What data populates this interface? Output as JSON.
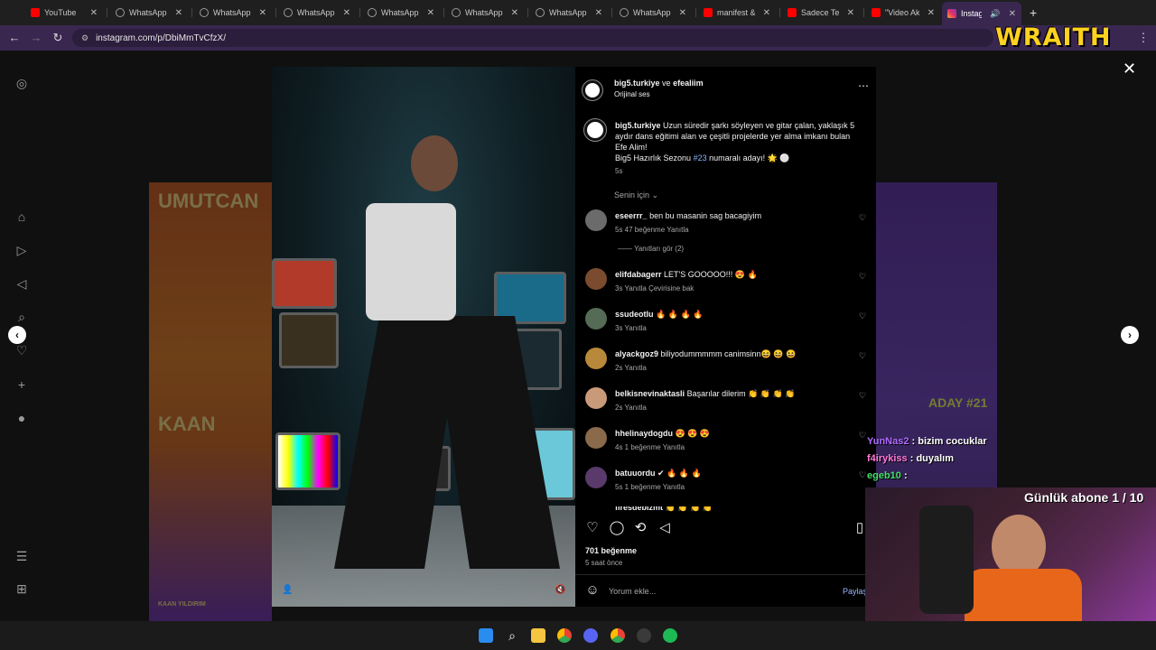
{
  "browser": {
    "tabs": [
      {
        "title": "YouTube",
        "icon": "youtube-icon"
      },
      {
        "title": "WhatsApp I",
        "icon": "whatsapp-icon"
      },
      {
        "title": "WhatsApp I",
        "icon": "whatsapp-icon"
      },
      {
        "title": "WhatsApp I",
        "icon": "whatsapp-icon"
      },
      {
        "title": "WhatsApp I",
        "icon": "whatsapp-icon"
      },
      {
        "title": "WhatsApp I",
        "icon": "whatsapp-icon"
      },
      {
        "title": "WhatsApp I",
        "icon": "whatsapp-icon"
      },
      {
        "title": "WhatsApp I",
        "icon": "whatsapp-icon"
      },
      {
        "title": "manifest & N",
        "icon": "youtube-icon"
      },
      {
        "title": "Sadece Teks",
        "icon": "youtube-icon"
      },
      {
        "title": "\"Video Akyo",
        "icon": "youtube-icon"
      },
      {
        "title": "Instagra",
        "icon": "instagram-icon",
        "active": true
      }
    ],
    "url": "instagram.com/p/DbiMmTvCfzX/",
    "new_tab": "+"
  },
  "overlay": {
    "brand": "WRAITH",
    "subscriber_goal": "Günlük abone 1 / 10",
    "chat": [
      {
        "user": "YunNas2",
        "message": ": bizim cocuklar",
        "color": "#b06bff"
      },
      {
        "user": "f4irykiss",
        "message": ": duyalım",
        "color": "#ff7ad9"
      },
      {
        "user": "egeb10",
        "message": ":",
        "color": "#45e06a"
      }
    ]
  },
  "posters": {
    "left_top_name": "UMUTCAN",
    "left_bottom_name": "KAAN",
    "left_caption": "KAAN YILDIRIM",
    "right_badge": "ADAY #21"
  },
  "post": {
    "header": {
      "user1": "big5.turkiye",
      "connector": "ve",
      "user2": "efealiim",
      "audio": "Orijinal ses"
    },
    "caption": {
      "user": "big5.turkiye",
      "text_line1": "Uzun süredir şarkı söyleyen ve gitar çalan, yaklaşık 5",
      "text_line2": "aydır dans eğitimi alan ve çeşitli projelerde yer alma imkanı bulan",
      "text_line3": "Efe Alim!",
      "text_line4_a": "Big5 Hazırlık Sezonu",
      "hashtag": "#23",
      "text_line4_b": "numaralı adayı! 🌟 ⚪",
      "time": "5s"
    },
    "sort": "Senin için",
    "view_replies": "Yanıtları gör (2)",
    "comments": [
      {
        "user": "eseerrr_",
        "text": "ben bu masanin sag bacagiyim",
        "meta": "5s   47 beğenme   Yanıtla",
        "avatar": "#6b6b6b"
      },
      {
        "user": "elifdabagerr",
        "text": "LET'S GOOOOO!!! 😍 🔥",
        "meta": "3s   Yanıtla   Çevirisine bak",
        "avatar": "#7a4b2f"
      },
      {
        "user": "ssudeotlu",
        "text": "🔥 🔥 🔥 🔥",
        "meta": "3s   Yanıtla",
        "avatar": "#556b55"
      },
      {
        "user": "alyackgoz9",
        "text": "biliyodummmmm canimsinn😆 😆 😆",
        "meta": "2s   Yanıtla",
        "avatar": "#b8893a"
      },
      {
        "user": "belkisnevinaktasli",
        "text": "Başarılar dilerim 👏 👏 👏 👏",
        "meta": "2s   Yanıtla",
        "avatar": "#c99a7a"
      },
      {
        "user": "hhelinaydogdu",
        "text": "😍 😍 😍",
        "meta": "4s   1 beğenme   Yanıtla",
        "avatar": "#8a6a4a"
      },
      {
        "user": "batuuordu",
        "text": "✔ 🔥 🔥 🔥",
        "meta": "5s   1 beğenme   Yanıtla",
        "avatar": "#5a3a6a"
      },
      {
        "user": "firesdebizmt",
        "text": "👏 👏 👏 👏",
        "meta": "",
        "avatar": "#4a4a4a"
      }
    ],
    "likes": "701 beğenme",
    "posted": "5 saat önce",
    "comment_placeholder": "Yorum ekle...",
    "share_label": "Paylaş"
  },
  "colors": {
    "tab_active": "#3a2750",
    "accent_link": "#8ab4ff",
    "brand_yellow": "#ffd21f"
  }
}
